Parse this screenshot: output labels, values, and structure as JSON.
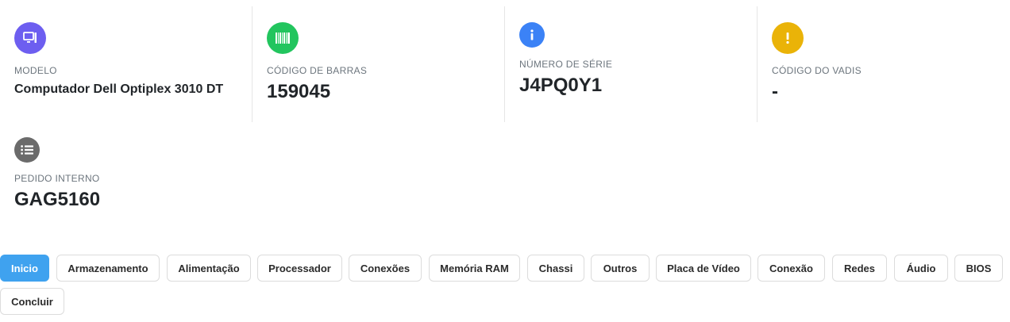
{
  "stats": {
    "modelo": {
      "label": "MODELO",
      "value": "Computador Dell Optiplex 3010 DT",
      "icon": "computer-icon",
      "color": "#6d5ef0"
    },
    "codigo_barras": {
      "label": "CÓDIGO DE BARRAS",
      "value": "159045",
      "icon": "barcode-icon",
      "color": "#22c55e"
    },
    "numero_serie": {
      "label": "NÚMERO DE SÉRIE",
      "value": "J4PQ0Y1",
      "icon": "info-icon",
      "color": "#3b82f6"
    },
    "codigo_vadis": {
      "label": "CÓDIGO DO VADIS",
      "value": "-",
      "icon": "exclamation-icon",
      "color": "#eab308"
    },
    "pedido_interno": {
      "label": "PEDIDO INTERNO",
      "value": "GAG5160",
      "icon": "list-icon",
      "color": "#6b6b6b"
    }
  },
  "tabs": [
    {
      "label": "Inicio",
      "active": true
    },
    {
      "label": "Armazenamento"
    },
    {
      "label": "Alimentação"
    },
    {
      "label": "Processador"
    },
    {
      "label": "Conexões"
    },
    {
      "label": "Memória RAM"
    },
    {
      "label": "Chassi"
    },
    {
      "label": "Outros"
    },
    {
      "label": "Placa de Vídeo"
    },
    {
      "label": "Conexão"
    },
    {
      "label": "Redes"
    },
    {
      "label": "Áudio"
    },
    {
      "label": "BIOS"
    },
    {
      "label": "Concluir"
    }
  ],
  "colors": {
    "active_tab": "#3fa2ef"
  }
}
